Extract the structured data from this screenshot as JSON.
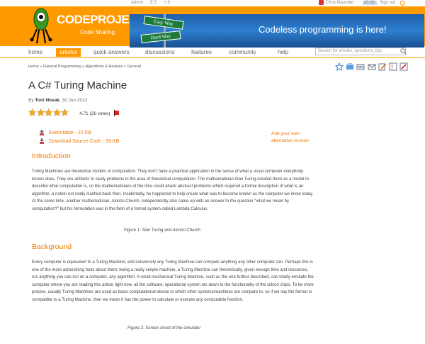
{
  "topbar": {
    "admin": "Admin",
    "views": "5",
    "comments": "0",
    "user": "Chris Maunder",
    "points": "45.6K",
    "signout": "Sign out"
  },
  "logo": {
    "code": "CODE",
    "project": "PROJECT",
    "sub": "Code Sharing"
  },
  "banner": {
    "sign1": "Easy Way",
    "sign2": "Hard Way",
    "message": "Codeless programming is here!"
  },
  "nav": {
    "items": [
      "home",
      "articles",
      "quick answers",
      "discussions",
      "features",
      "community",
      "help"
    ],
    "search_placeholder": "Search for articles, questions, tips"
  },
  "breadcrumb": "Home » General Programming » Algorithms & Recipes » General",
  "article": {
    "title": "A C# Turing Machine",
    "by": "By ",
    "author": "Toni Novak",
    "date": ", 30 Jun 2012",
    "rating": "4.71 (26 votes)",
    "rating_value": 4.71,
    "downloads": [
      "Executable - 22 KB",
      "Download Source Code - 39 KB"
    ],
    "alt_version": [
      "Add your own",
      "alternative version"
    ]
  },
  "sections": [
    {
      "heading": "Introduction",
      "text": "Turing Machines are theoretical models of computation. They don't have a practical application in the sense of what a usual computer everybody knows does. They are artifacts to study problems in the area of theoretical computation. The mathematician Alan Turing created them as a model to describe what computation is, so the mathematicians of the time could attack abstract problems which required a formal description of what is an algorithm, a notion not really clarified back then. Incidentally, he happened to help create what was to become known as the computer we know today. At the same time, another mathematician, Alonzo Church, independently also came up with an answer to the question \"what we mean by computation?\" but his formulation was in the form of a formal system called Lambda Calculus.",
      "caption": "Figure 1: Alan Turing and Alonzo Church"
    },
    {
      "heading": "Background",
      "text": "Every computer is equivalent to a Turing Machine, and conversely any Turing Machine can compute anything any other computer can. Perhaps this is one of the more astonishing facts about them: being a really simple machine, a Turing Machine can theoretically, given enough time and resources, run anything you can run on a computer, any algorithm. A small mechanical Turing Machine, such as the one further described, can totally emulate the computer where you are reading this article right now, all the software, operational system etc down to the functionality of the silicon chips. To be more precise, usually Turing Machines are used as basic computational device to which other systems/machines are compare to, so if we say the former is compatible to a Turing Machine, then we mean it has the power to calculate or execute any computable function.",
      "caption": "Figure 2: Screen shoot of the simulator"
    }
  ]
}
